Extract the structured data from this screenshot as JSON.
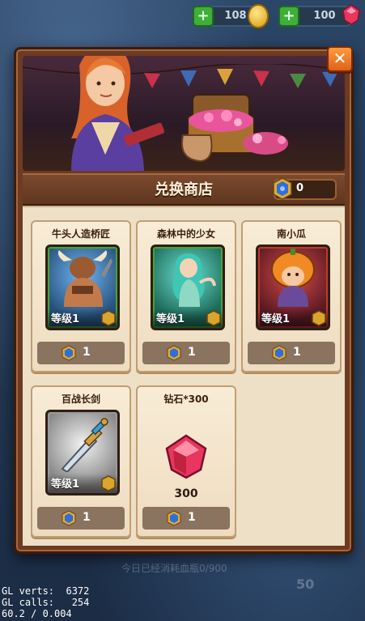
{
  "resources": {
    "coins": "108",
    "gems": "100"
  },
  "shop": {
    "title": "兑换商店",
    "currency_amount": "0",
    "close_label": "✕"
  },
  "items": [
    {
      "name": "牛头人造桥匠",
      "level": "等级1",
      "price": "1"
    },
    {
      "name": "森林中的少女",
      "level": "等级1",
      "price": "1"
    },
    {
      "name": "南小瓜",
      "level": "等级1",
      "price": "1"
    },
    {
      "name": "百战长剑",
      "level": "等级1",
      "price": "1"
    },
    {
      "name": "钻石*300",
      "amount": "300",
      "price": "1"
    }
  ],
  "background": {
    "faded_text": "今日已经消耗血瓶0/900",
    "faded_number": "50"
  },
  "debug": {
    "line1": "GL verts:  6372",
    "line2": "GL calls:   254",
    "line3": "60.2 / 0.004"
  },
  "colors": {
    "accent_orange": "#e0611a",
    "panel_brown": "#6d3a22",
    "card_bg": "#f8ecd6",
    "gem_pink": "#e8365e"
  }
}
